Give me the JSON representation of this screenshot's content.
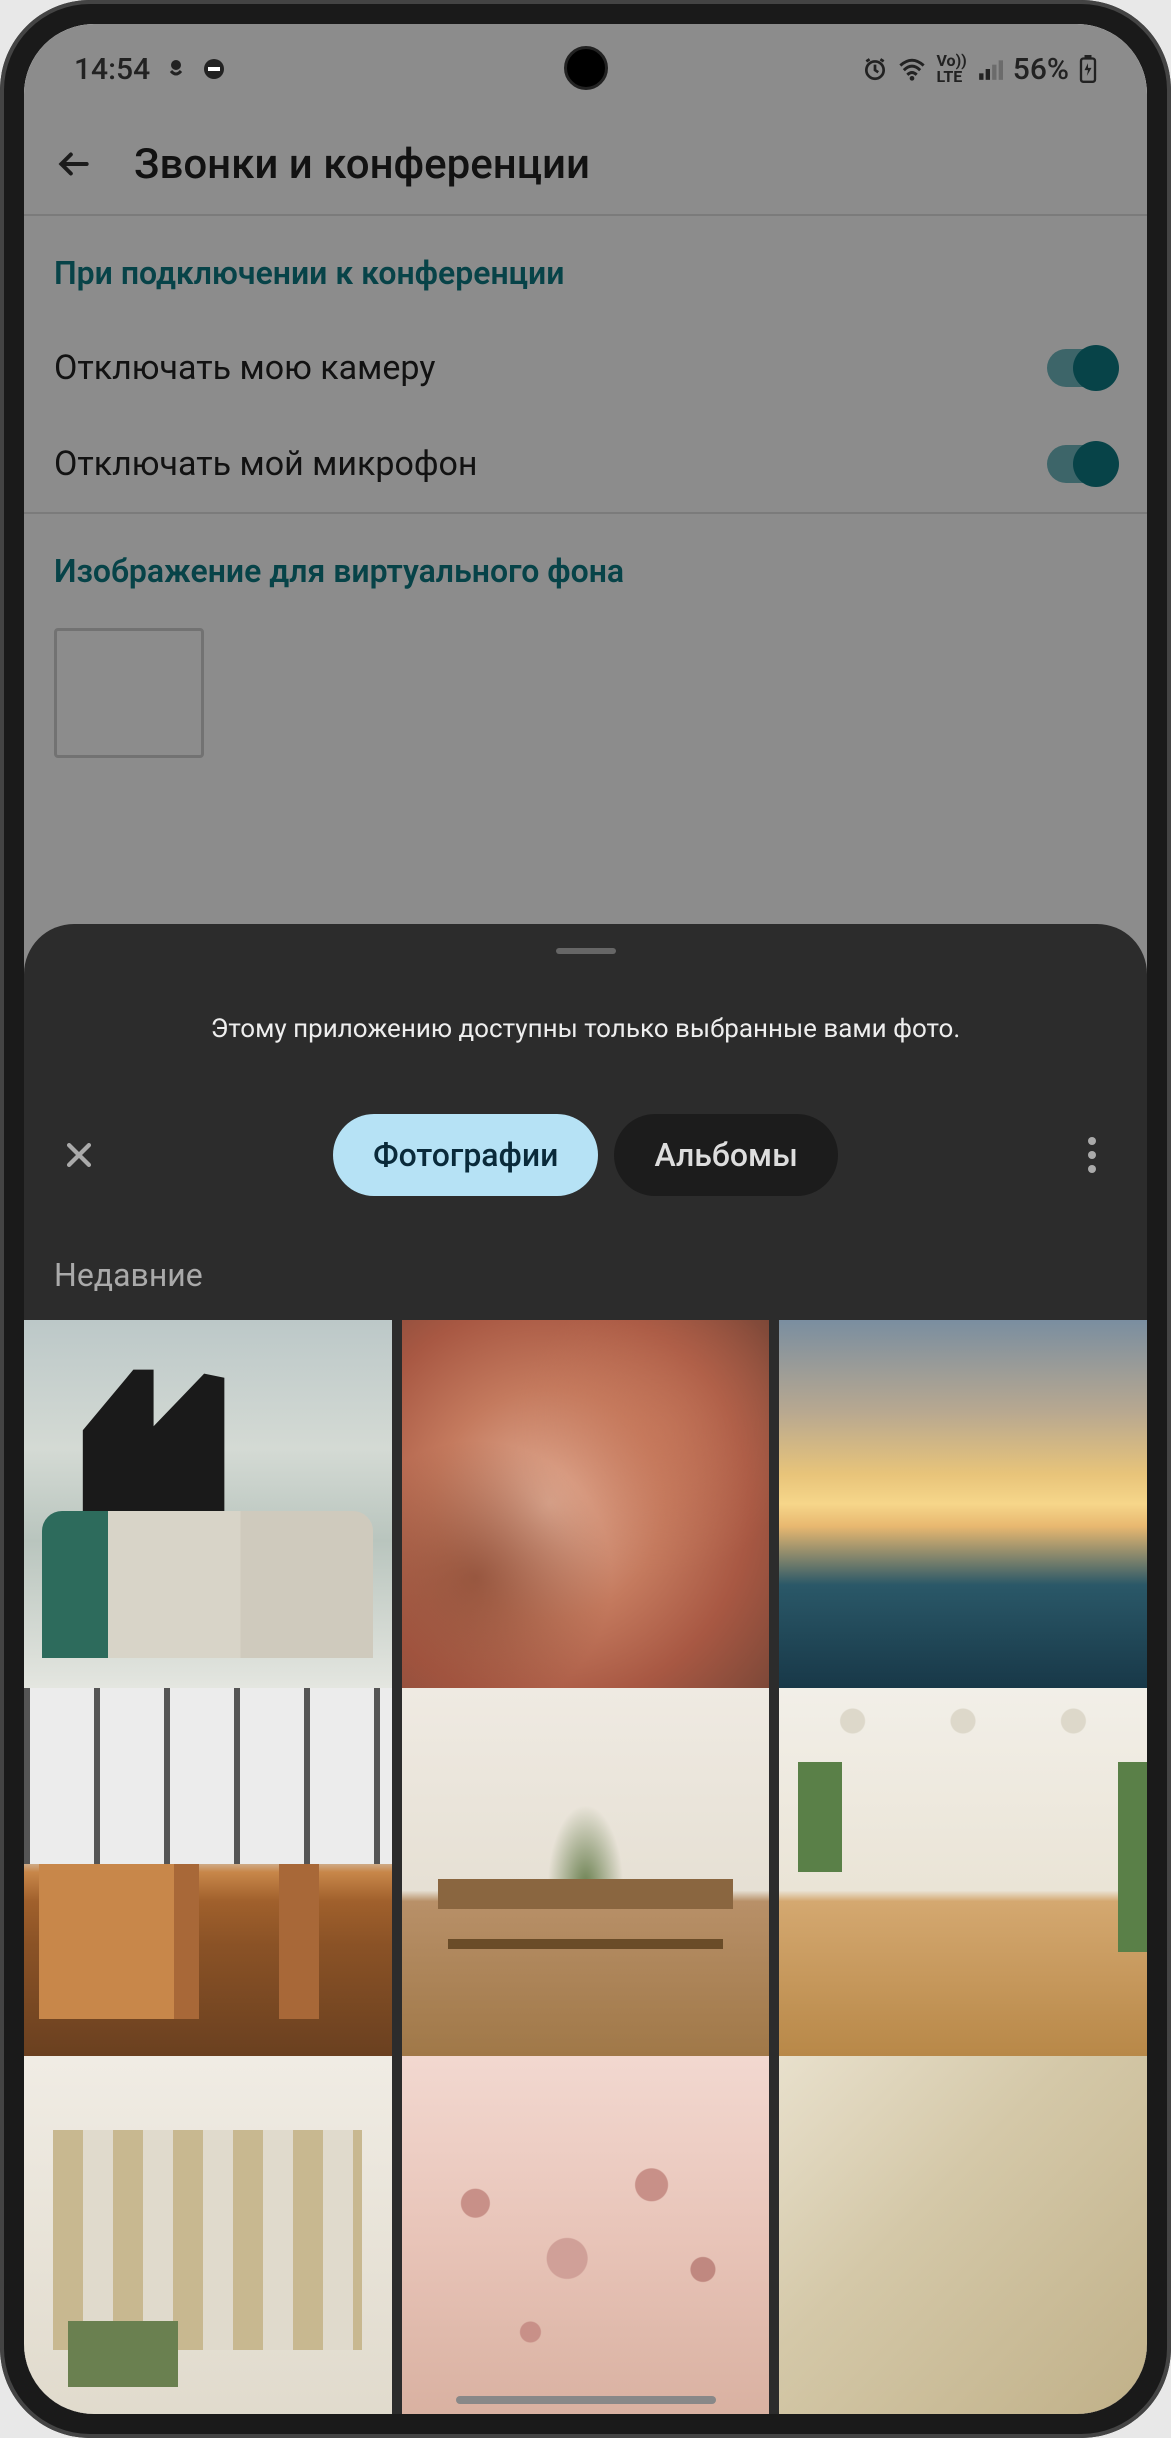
{
  "status": {
    "time": "14:54",
    "battery": "56%"
  },
  "header": {
    "title": "Звонки и конференции"
  },
  "settings": {
    "section1_title": "При подключении к конференции",
    "disable_camera": "Отключать мою камеру",
    "disable_mic": "Отключать мой микрофон",
    "section2_title": "Изображение для виртуального фона"
  },
  "sheet": {
    "hint": "Этому приложению доступны только выбранные вами фото.",
    "tab_photos": "Фотографии",
    "tab_albums": "Альбомы",
    "recent": "Недавние"
  }
}
